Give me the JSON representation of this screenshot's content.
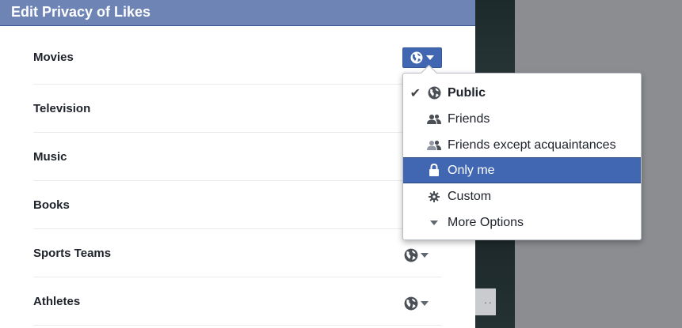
{
  "dialog": {
    "title": "Edit Privacy of Likes",
    "rows": [
      {
        "label": "Movies",
        "privacy_icon": "globe-icon",
        "active": true
      },
      {
        "label": "Television",
        "privacy_icon": "globe-icon"
      },
      {
        "label": "Music",
        "privacy_icon": "globe-icon"
      },
      {
        "label": "Books",
        "privacy_icon": "globe-icon"
      },
      {
        "label": "Sports Teams",
        "privacy_icon": "globe-icon"
      },
      {
        "label": "Athletes",
        "privacy_icon": "globe-icon"
      }
    ]
  },
  "privacy_menu": {
    "items": [
      {
        "label": "Public",
        "icon": "globe-icon",
        "checked": true
      },
      {
        "label": "Friends",
        "icon": "friends-icon"
      },
      {
        "label": "Friends except acquaintances",
        "icon": "friends-except-icon"
      },
      {
        "label": "Only me",
        "icon": "lock-icon",
        "highlighted": true
      },
      {
        "label": "Custom",
        "icon": "gear-icon"
      },
      {
        "label": "More Options",
        "icon": "caret-down-icon"
      }
    ]
  },
  "colors": {
    "header": "#6d84b4",
    "accent": "#4267b2",
    "background_overlay": "#8b8d91"
  }
}
